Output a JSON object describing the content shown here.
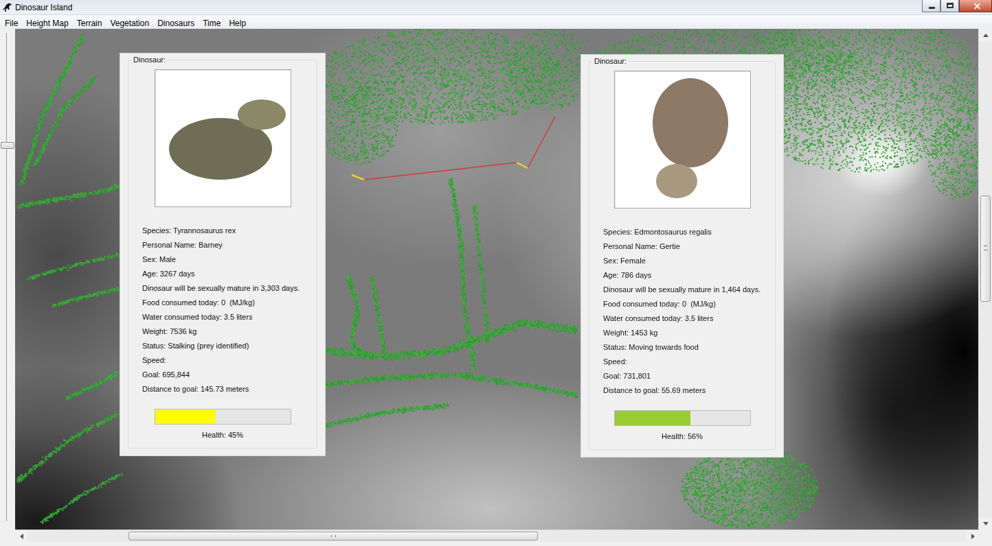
{
  "window": {
    "title": "Dinosaur Island"
  },
  "menu": [
    "File",
    "Height Map",
    "Terrain",
    "Vegetation",
    "Dinosaurs",
    "Time",
    "Help"
  ],
  "zoom_slider": {
    "level": 0.23
  },
  "dinosaurs": [
    {
      "group_label": "Dinosaur:",
      "lines": [
        "Species: Tyrannosaurus rex",
        "Personal Name: Barney",
        "Sex: Male",
        "Age: 3267 days",
        "Dinosaur will be sexually mature in 3,303 days.",
        "Food consumed today: 0  (MJ/kg)",
        "Water consumed today: 3.5 liters",
        "Weight: 7536 kg",
        "Status: Stalking (prey identified)",
        "Speed:",
        "Goal: 695,844",
        "Distance to goal: 145.73 meters"
      ],
      "health": {
        "level": 0.45,
        "color": "#ffff00",
        "label": "Health: 45%"
      }
    },
    {
      "group_label": "Dinosaur:",
      "lines": [
        "Species: Edmontosaurus regalis",
        "Personal Name: Gertie",
        "Sex: Female",
        "Age: 786 days",
        "Dinosaur will be sexually mature in 1,464 days.",
        "Food consumed today: 0  (MJ/kg)",
        "Water consumed today: 3.5 liters",
        "Weight: 1453 kg",
        "Status: Moving towards food",
        "Speed:",
        "Goal: 731,801",
        "Distance to goal: 55.69 meters"
      ],
      "health": {
        "level": 0.56,
        "color": "#9acd32",
        "label": "Health: 56%"
      }
    }
  ]
}
